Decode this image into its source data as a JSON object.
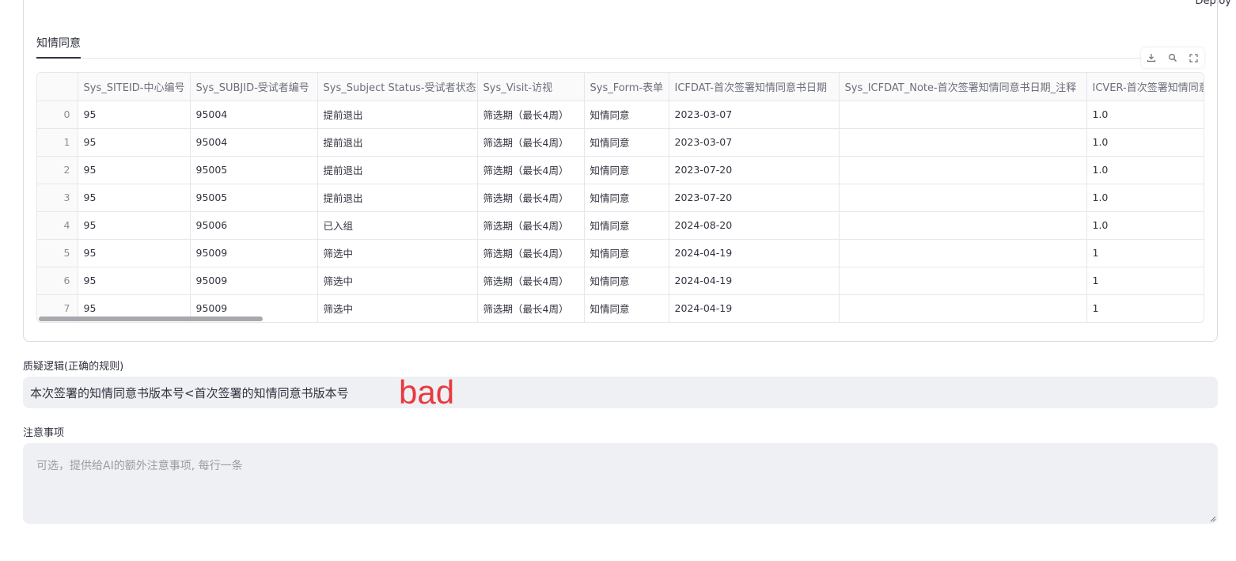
{
  "header": {
    "deploy_label": "Deploy"
  },
  "tabs": [
    {
      "label": "知情同意"
    }
  ],
  "toolbar": {
    "download_icon": "download-icon",
    "search_icon": "search-icon",
    "fullscreen_icon": "fullscreen-icon"
  },
  "table": {
    "columns": [
      "",
      "Sys_SITEID-中心编号",
      "Sys_SUBJID-受试者编号",
      "Sys_Subject Status-受试者状态",
      "Sys_Visit-访视",
      "Sys_Form-表单",
      "ICFDAT-首次签署知情同意书日期",
      "Sys_ICFDAT_Note-首次签署知情同意书日期_注释",
      "ICVER-首次签署知情同意"
    ],
    "rows": [
      [
        "0",
        "95",
        "95004",
        "提前退出",
        "筛选期（最长4周）",
        "知情同意",
        "2023-03-07",
        "",
        "1.0"
      ],
      [
        "1",
        "95",
        "95004",
        "提前退出",
        "筛选期（最长4周）",
        "知情同意",
        "2023-03-07",
        "",
        "1.0"
      ],
      [
        "2",
        "95",
        "95005",
        "提前退出",
        "筛选期（最长4周）",
        "知情同意",
        "2023-07-20",
        "",
        "1.0"
      ],
      [
        "3",
        "95",
        "95005",
        "提前退出",
        "筛选期（最长4周）",
        "知情同意",
        "2023-07-20",
        "",
        "1.0"
      ],
      [
        "4",
        "95",
        "95006",
        "已入组",
        "筛选期（最长4周）",
        "知情同意",
        "2024-08-20",
        "",
        "1.0"
      ],
      [
        "5",
        "95",
        "95009",
        "筛选中",
        "筛选期（最长4周）",
        "知情同意",
        "2024-04-19",
        "",
        "1"
      ],
      [
        "6",
        "95",
        "95009",
        "筛选中",
        "筛选期（最长4周）",
        "知情同意",
        "2024-04-19",
        "",
        "1"
      ],
      [
        "7",
        "95",
        "95009",
        "筛选中",
        "筛选期（最长4周）",
        "知情同意",
        "2024-04-19",
        "",
        "1"
      ]
    ]
  },
  "query_logic": {
    "label": "质疑逻辑(正确的规则)",
    "value": "本次签署的知情同意书版本号<首次签署的知情同意书版本号",
    "annotation": "bad"
  },
  "notes": {
    "label": "注意事项",
    "placeholder": "可选，提供给AI的额外注意事项, 每行一条"
  },
  "colors": {
    "annotation": "#e8393f",
    "input_bg": "#eef0f4",
    "border": "#e6e7eb"
  }
}
